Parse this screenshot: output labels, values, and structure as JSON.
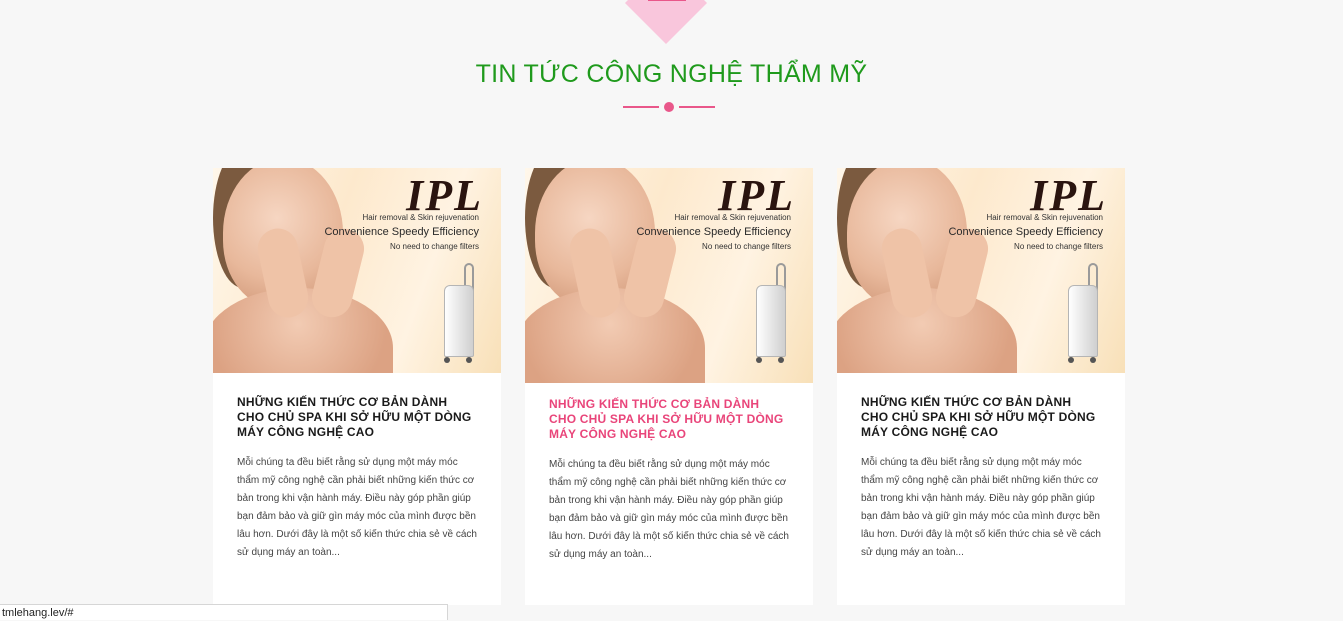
{
  "section": {
    "title": "TIN TỨC CÔNG NGHỆ THẨM MỸ"
  },
  "colors": {
    "title_green": "#1f9a1c",
    "accent_pink": "#e9578a",
    "highlight_title": "#e9457a"
  },
  "cards": [
    {
      "image": {
        "brand": "IPL",
        "subtitle": "Hair removal & Skin rejuvenation",
        "tagline": "Convenience  Speedy Efficiency",
        "note": "No need to change filters"
      },
      "title": "NHỮNG KIẾN THỨC CƠ BẢN DÀNH CHO CHỦ SPA KHI SỞ HỮU MỘT DÒNG MÁY CÔNG NGHỆ CAO",
      "excerpt": "Mỗi chúng ta đều biết rằng sử dụng một máy móc thẩm mỹ công nghệ cần phải biết những kiến thức cơ bản trong khi vận hành máy. Điều này góp phần giúp bạn đảm bảo và giữ gìn máy móc của mình được bền lâu hơn. Dưới đây là một số kiến thức chia sẻ về cách sử dụng máy an toàn..."
    },
    {
      "image": {
        "brand": "IPL",
        "subtitle": "Hair removal & Skin rejuvenation",
        "tagline": "Convenience  Speedy Efficiency",
        "note": "No need to change filters"
      },
      "title": "NHỮNG KIẾN THỨC CƠ BẢN DÀNH CHO CHỦ SPA KHI SỞ HỮU MỘT DÒNG MÁY CÔNG NGHỆ CAO",
      "excerpt": "Mỗi chúng ta đều biết rằng sử dụng một máy móc thẩm mỹ công nghệ cần phải biết những kiến thức cơ bản trong khi vận hành máy. Điều này góp phần giúp bạn đảm bảo và giữ gìn máy móc của mình được bền lâu hơn. Dưới đây là một số kiến thức chia sẻ về cách sử dụng máy an toàn..."
    },
    {
      "image": {
        "brand": "IPL",
        "subtitle": "Hair removal & Skin rejuvenation",
        "tagline": "Convenience  Speedy Efficiency",
        "note": "No need to change filters"
      },
      "title": "NHỮNG KIẾN THỨC CƠ BẢN DÀNH CHO CHỦ SPA KHI SỞ HỮU MỘT DÒNG MÁY CÔNG NGHỆ CAO",
      "excerpt": "Mỗi chúng ta đều biết rằng sử dụng một máy móc thẩm mỹ công nghệ cần phải biết những kiến thức cơ bản trong khi vận hành máy. Điều này góp phần giúp bạn đảm bảo và giữ gìn máy móc của mình được bền lâu hơn. Dưới đây là một số kiến thức chia sẻ về cách sử dụng máy an toàn..."
    }
  ],
  "status_bar": {
    "url": "tmlehang.lev/#"
  }
}
